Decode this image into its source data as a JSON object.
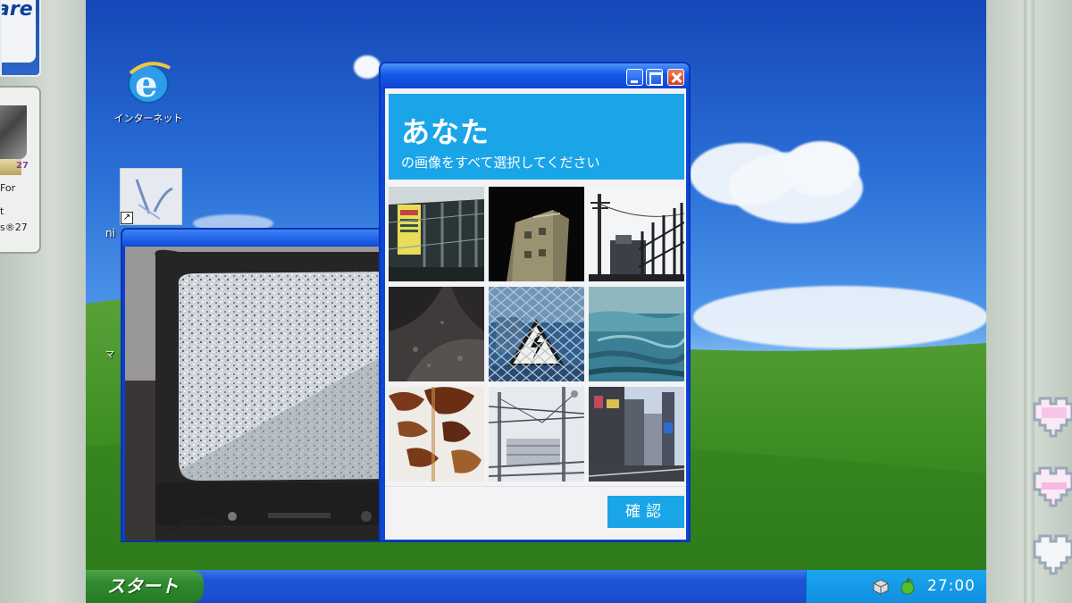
{
  "desktop": {
    "icons": [
      {
        "label": "インターネット"
      }
    ],
    "fragments": {
      "left_ni": "ni",
      "left_ma": "マ"
    }
  },
  "stickers": {
    "top_text": "are",
    "win_lines": [
      "For",
      "t",
      "s®27"
    ],
    "win_number": "27"
  },
  "captcha": {
    "title": "あなた",
    "subtitle": "の画像をすべて選択してください",
    "verify_label": "確認",
    "tiles": [
      "fence-sign",
      "dark-building",
      "power-pole-fence",
      "dark-ground",
      "high-voltage-sign",
      "water-surface",
      "rusty-metal",
      "railway-lines",
      "city-street"
    ]
  },
  "taskbar": {
    "start_label": "スタート",
    "clock": "27:00"
  },
  "colors": {
    "accent": "#1aa5e8",
    "xp_blue": "#0c46d6",
    "start_green": "#2f8a2f"
  }
}
